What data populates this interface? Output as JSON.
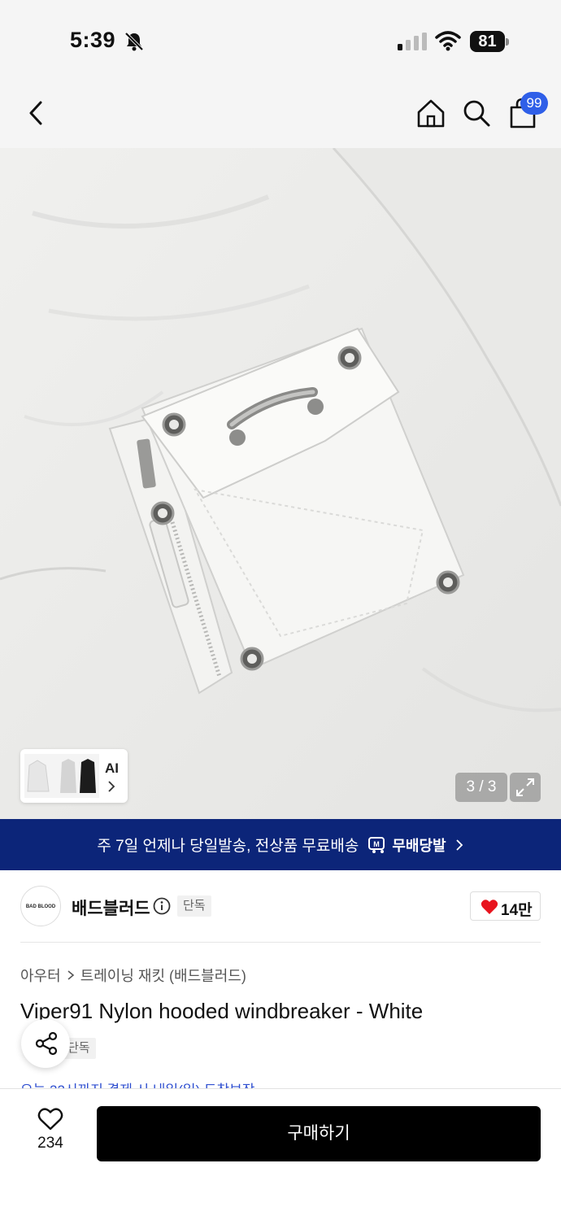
{
  "status_bar": {
    "time": "5:39",
    "battery": "81"
  },
  "nav": {
    "cart_badge": "99"
  },
  "gallery": {
    "counter": "3 / 3",
    "ai_label": "AI"
  },
  "promo": {
    "text": "주 7일 언제나 당일발송, 전상품 무료배송",
    "brand": "무배당발"
  },
  "brand": {
    "logo_text": "BAD BLOOD",
    "name": "배드블러드",
    "tag": "단독",
    "likes": "14만"
  },
  "category": {
    "items": [
      "아우터",
      "트레이닝 재킷 (배드블러드)"
    ]
  },
  "product": {
    "title": "Viper91 Nylon hooded windbreaker - White",
    "tag": "단독",
    "delivery_peek": "오늘 22시까지 결제 시 내일(일) 도착보장"
  },
  "bottom_bar": {
    "wish_count": "234",
    "buy_label": "구매하기"
  },
  "colors": {
    "accent": "#2f5fe8",
    "banner": "#0c2579",
    "heart": "#e8141e"
  }
}
